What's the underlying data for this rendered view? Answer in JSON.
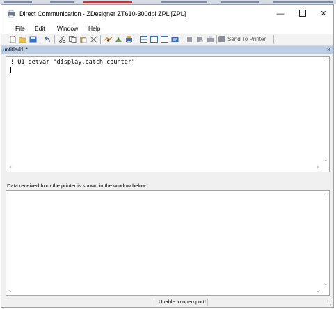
{
  "window": {
    "title": "Direct Communication - ZDesigner ZT610-300dpi ZPL [ZPL]",
    "controls": {
      "minimize": "—",
      "close": "✕"
    }
  },
  "menu": [
    "File",
    "Edit",
    "Window",
    "Help"
  ],
  "toolbar": {
    "send_label": "Send To Printer"
  },
  "document_tab": {
    "label": "untitled1 *",
    "close": "×"
  },
  "editor": {
    "content": "! U1 getvar \"display.batch_counter\""
  },
  "output_panel": {
    "label": "Data received from the printer is shown in the window below."
  },
  "status": {
    "message": "Unable to open port!"
  },
  "colors": {
    "tab_bg": "#bccde6",
    "window_bg": "#f0f0f0",
    "title_bg": "#ffffff"
  }
}
